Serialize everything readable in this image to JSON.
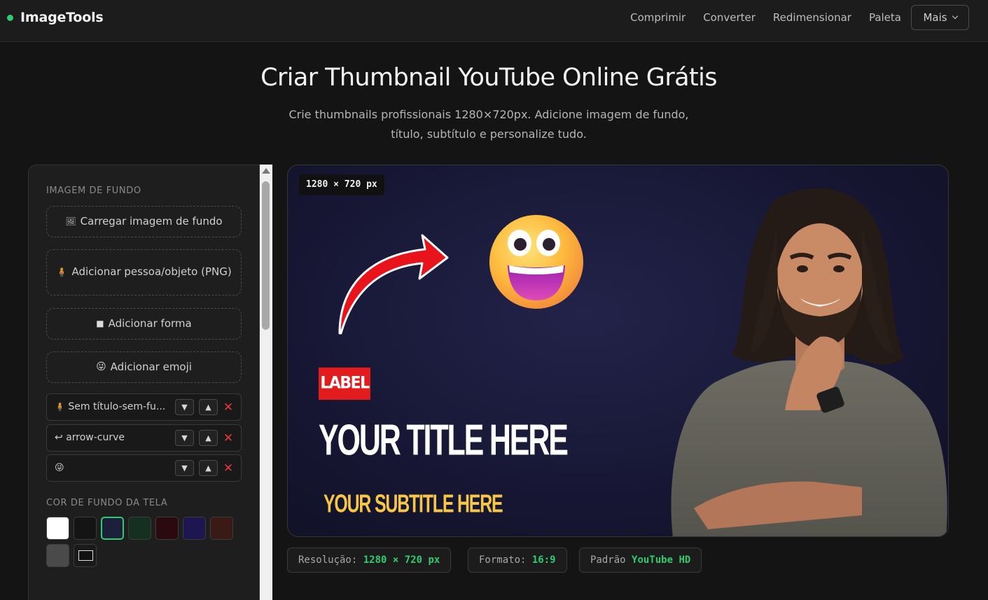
{
  "brand": {
    "name": "ImageTools",
    "accent": "#2ecc71"
  },
  "nav": {
    "links": [
      "Comprimir",
      "Converter",
      "Redimensionar",
      "Paleta"
    ],
    "more_label": "Mais"
  },
  "hero": {
    "title": "Criar Thumbnail YouTube Online Grátis",
    "subtitle_line1": "Crie thumbnails profissionais 1280×720px. Adicione imagem de fundo,",
    "subtitle_line2": "título, subtítulo e personalize tudo."
  },
  "sidebar": {
    "bg_section_title": "IMAGEM DE FUNDO",
    "buttons": {
      "upload_bg": {
        "icon": "🖼",
        "label": "Carregar imagem de fundo"
      },
      "add_person": {
        "icon": "🧍",
        "label": "Adicionar pessoa/objeto (PNG)"
      },
      "add_shape": {
        "icon": "■",
        "label": "Adicionar forma"
      },
      "add_emoji": {
        "icon": "😜",
        "label": "Adicionar emoji"
      }
    },
    "layers": [
      {
        "icon": "🧍",
        "label": "Sem título-sem-fu..."
      },
      {
        "icon": "↩",
        "label": "arrow-curve"
      },
      {
        "icon": "😜",
        "label": ""
      }
    ],
    "layer_controls": {
      "down": "▼",
      "up": "▲",
      "delete": "✕"
    },
    "color_section_title": "COR DE FUNDO DA TELA",
    "swatches": [
      "#ffffff",
      "#141414",
      "#1b1f3a",
      "#15301f",
      "#2a0a0e",
      "#1e1650",
      "#3a1a14",
      "#4a4a4a"
    ],
    "selected_swatch": "#1b1f3a"
  },
  "canvas": {
    "size_badge": "1280 × 720 px",
    "label_text": "LABEL",
    "title_text": "YOUR TITLE HERE",
    "subtitle_text": "YOUR SUBTITLE HERE",
    "label_color": "#e21c1c",
    "subtitle_color": "#f6c744"
  },
  "info": {
    "resolution_label": "Resolução:",
    "resolution_value": "1280 × 720 px",
    "format_label": "Formato:",
    "format_value": "16:9",
    "standard_label": "Padrão",
    "standard_value": "YouTube HD"
  }
}
